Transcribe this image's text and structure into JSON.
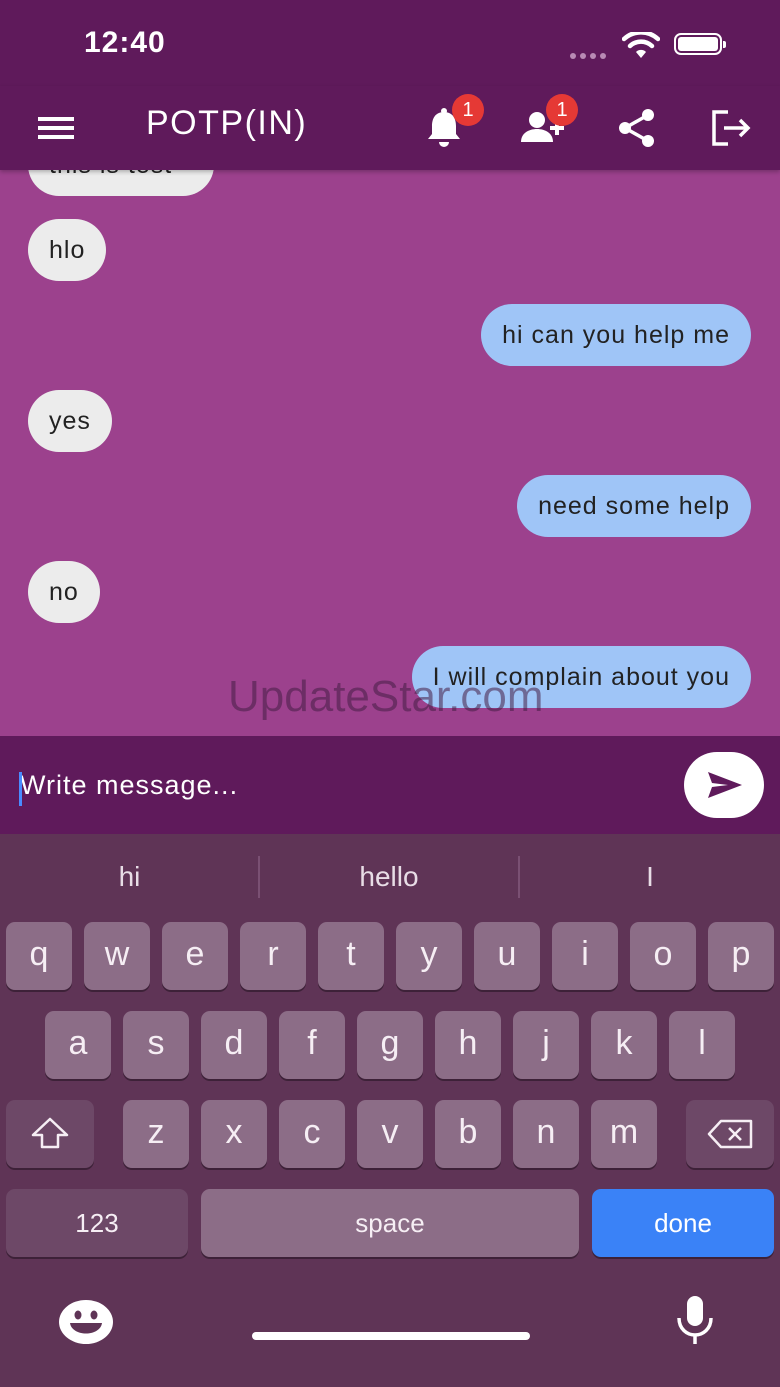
{
  "status_bar": {
    "time": "12:40"
  },
  "app_bar": {
    "title": "POTP(IN)",
    "notifications_badge": "1",
    "friend_requests_badge": "1"
  },
  "messages": [
    {
      "text": "this is test",
      "direction": "incoming"
    },
    {
      "text": "hlo",
      "direction": "incoming"
    },
    {
      "text": "hi can you help me",
      "direction": "outgoing"
    },
    {
      "text": "yes",
      "direction": "incoming"
    },
    {
      "text": "need some help",
      "direction": "outgoing"
    },
    {
      "text": "no",
      "direction": "incoming"
    },
    {
      "text": "I will complain about you",
      "direction": "outgoing"
    }
  ],
  "watermark": "UpdateStar.com",
  "composer": {
    "placeholder": "Write message...",
    "value": ""
  },
  "keyboard": {
    "suggestions": [
      "hi",
      "hello",
      "I"
    ],
    "row1": [
      "q",
      "w",
      "e",
      "r",
      "t",
      "y",
      "u",
      "i",
      "o",
      "p"
    ],
    "row2": [
      "a",
      "s",
      "d",
      "f",
      "g",
      "h",
      "j",
      "k",
      "l"
    ],
    "row3": [
      "z",
      "x",
      "c",
      "v",
      "b",
      "n",
      "m"
    ],
    "numbers_label": "123",
    "space_label": "space",
    "done_label": "done"
  },
  "colors": {
    "app_bar": "#5f1a5b",
    "chat_background": "#9c418d",
    "incoming_bubble": "#ececec",
    "outgoing_bubble": "#9fc5f7",
    "badge": "#e53935",
    "done_key": "#3a82f7"
  },
  "icons": [
    "menu-icon",
    "bell-icon",
    "add-user-icon",
    "share-icon",
    "logout-icon",
    "send-icon",
    "shift-icon",
    "backspace-icon",
    "emoji-icon",
    "microphone-icon"
  ]
}
